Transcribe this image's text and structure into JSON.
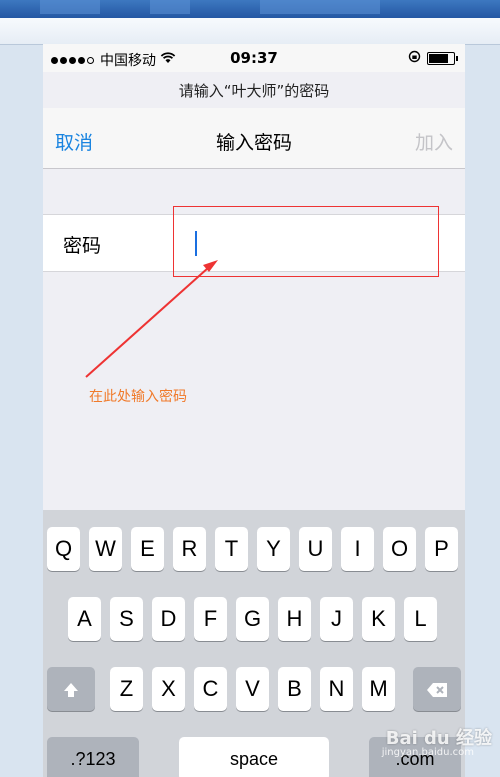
{
  "status": {
    "carrier": "中国移动",
    "time": "09:37",
    "wifi_icon": "wifi-icon",
    "lock_icon": "rotation-lock-icon",
    "battery_icon": "battery-icon"
  },
  "prompt": {
    "subtitle": "请输入“叶大师”的密码"
  },
  "nav": {
    "cancel_label": "取消",
    "title": "输入密码",
    "join_label": "加入"
  },
  "password_field": {
    "label": "密码",
    "value": ""
  },
  "annotation": {
    "hint": "在此处输入密码",
    "color": "#f07a2a",
    "box_color": "#e33333"
  },
  "keyboard": {
    "row1": [
      "Q",
      "W",
      "E",
      "R",
      "T",
      "Y",
      "U",
      "I",
      "O",
      "P"
    ],
    "row2": [
      "A",
      "S",
      "D",
      "F",
      "G",
      "H",
      "J",
      "K",
      "L"
    ],
    "row3": [
      "Z",
      "X",
      "C",
      "V",
      "B",
      "N",
      "M"
    ],
    "shift_icon": "shift-icon",
    "delete_icon": "delete-icon",
    "numbers_label": ".?123",
    "space_label": "space",
    "return_label": ".com"
  },
  "watermark": {
    "logo": "Bai du 经验",
    "sub": "jingyan.baidu.com"
  }
}
